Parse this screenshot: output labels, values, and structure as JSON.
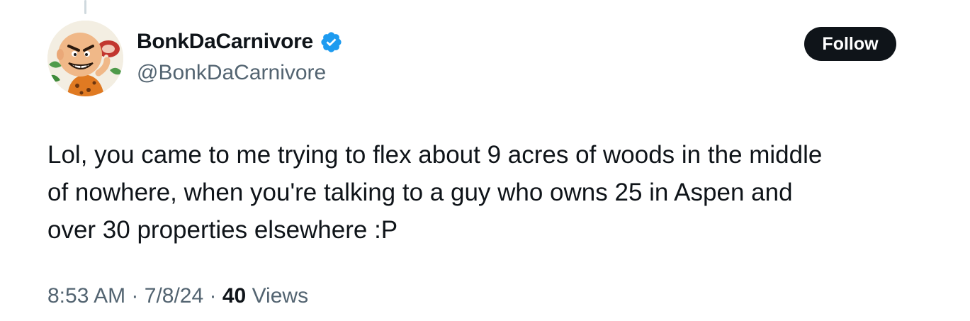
{
  "author": {
    "display_name": "BonkDaCarnivore",
    "handle": "@BonkDaCarnivore",
    "verified": true,
    "avatar_icon": "cartoon-caveman-avatar"
  },
  "actions": {
    "follow_label": "Follow"
  },
  "tweet": {
    "text": "Lol, you came to me trying to flex about 9 acres of woods in the middle\nof nowhere, when you're talking to a guy who owns 25 in Aspen and\nover 30 properties elsewhere :P",
    "time": "8:53 AM",
    "date": "7/8/24",
    "separator": "·",
    "views_count": "40",
    "views_label": "Views"
  },
  "colors": {
    "text_primary": "#0f1419",
    "text_secondary": "#536471",
    "verified_blue": "#1d9bf0",
    "follow_button_bg": "#0f1419",
    "thread_line": "#cfd9de"
  }
}
